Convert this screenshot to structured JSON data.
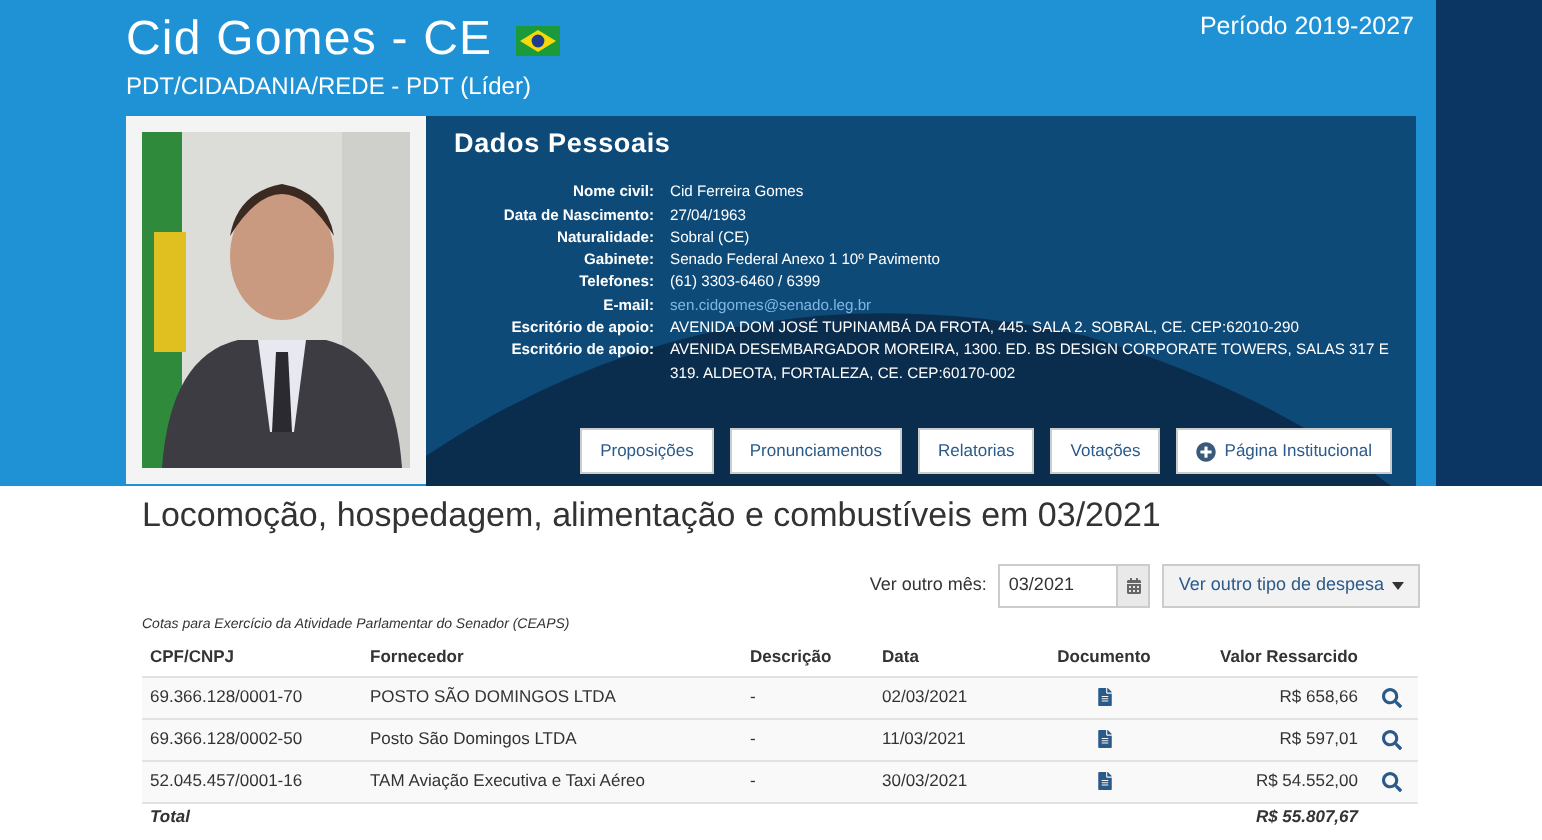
{
  "header": {
    "name": "Cid Gomes - CE",
    "party": "PDT/CIDADANIA/REDE - PDT (Líder)",
    "period": "Período 2019-2027"
  },
  "personal": {
    "title": "Dados Pessoais",
    "fields": [
      {
        "label": "Nome civil:",
        "value": "Cid Ferreira Gomes",
        "kind": "text"
      },
      {
        "label": "Data de Nascimento:",
        "value": "27/04/1963",
        "kind": "text"
      },
      {
        "label": "Naturalidade:",
        "value": "Sobral (CE)",
        "kind": "text"
      },
      {
        "label": "Gabinete:",
        "value": "Senado Federal Anexo 1 10º Pavimento",
        "kind": "text"
      },
      {
        "label": "Telefones:",
        "value": "(61) 3303-6460 / 6399",
        "kind": "text"
      },
      {
        "label": "E-mail:",
        "value": "sen.cidgomes@senado.leg.br",
        "kind": "link"
      },
      {
        "label": "Escritório de apoio:",
        "value": "AVENIDA DOM JOSÉ TUPINAMBÁ DA FROTA, 445. SALA 2. SOBRAL, CE. CEP:62010-290",
        "kind": "text"
      },
      {
        "label": "Escritório de apoio:",
        "value": "AVENIDA DESEMBARGADOR MOREIRA, 1300. ED. BS DESIGN CORPORATE TOWERS, SALAS 317 E 319. ALDEOTA, FORTALEZA, CE. CEP:60170-002",
        "kind": "text"
      }
    ],
    "buttons": [
      {
        "label": "Proposições",
        "kind": "plain"
      },
      {
        "label": "Pronunciamentos",
        "kind": "plain"
      },
      {
        "label": "Relatorias",
        "kind": "plain"
      },
      {
        "label": "Votações",
        "kind": "plain"
      },
      {
        "label": "Página Institucional",
        "kind": "plus"
      }
    ]
  },
  "heading": "Locomoção, hospedagem, alimentação e combustíveis em 03/2021",
  "filters": {
    "month_label": "Ver outro mês:",
    "month_value": "03/2021",
    "type_button": "Ver outro tipo de despesa"
  },
  "table": {
    "caption": "Cotas para Exercício da Atividade Parlamentar do Senador (CEAPS)",
    "columns": [
      "CPF/CNPJ",
      "Fornecedor",
      "Descrição",
      "Data",
      "Documento",
      "Valor Ressarcido"
    ],
    "rows": [
      {
        "cpf": "69.366.128/0001-70",
        "supplier": "POSTO SÃO DOMINGOS LTDA",
        "description": "-",
        "date": "02/03/2021",
        "value": "R$ 658,66"
      },
      {
        "cpf": "69.366.128/0002-50",
        "supplier": "Posto São Domingos LTDA",
        "description": "-",
        "date": "11/03/2021",
        "value": "R$ 597,01"
      },
      {
        "cpf": "52.045.457/0001-16",
        "supplier": "TAM Aviação Executiva e Taxi Aéreo",
        "description": "-",
        "date": "30/03/2021",
        "value": "R$ 54.552,00"
      }
    ],
    "total_label": "Total",
    "total_value": "R$ 55.807,67"
  }
}
